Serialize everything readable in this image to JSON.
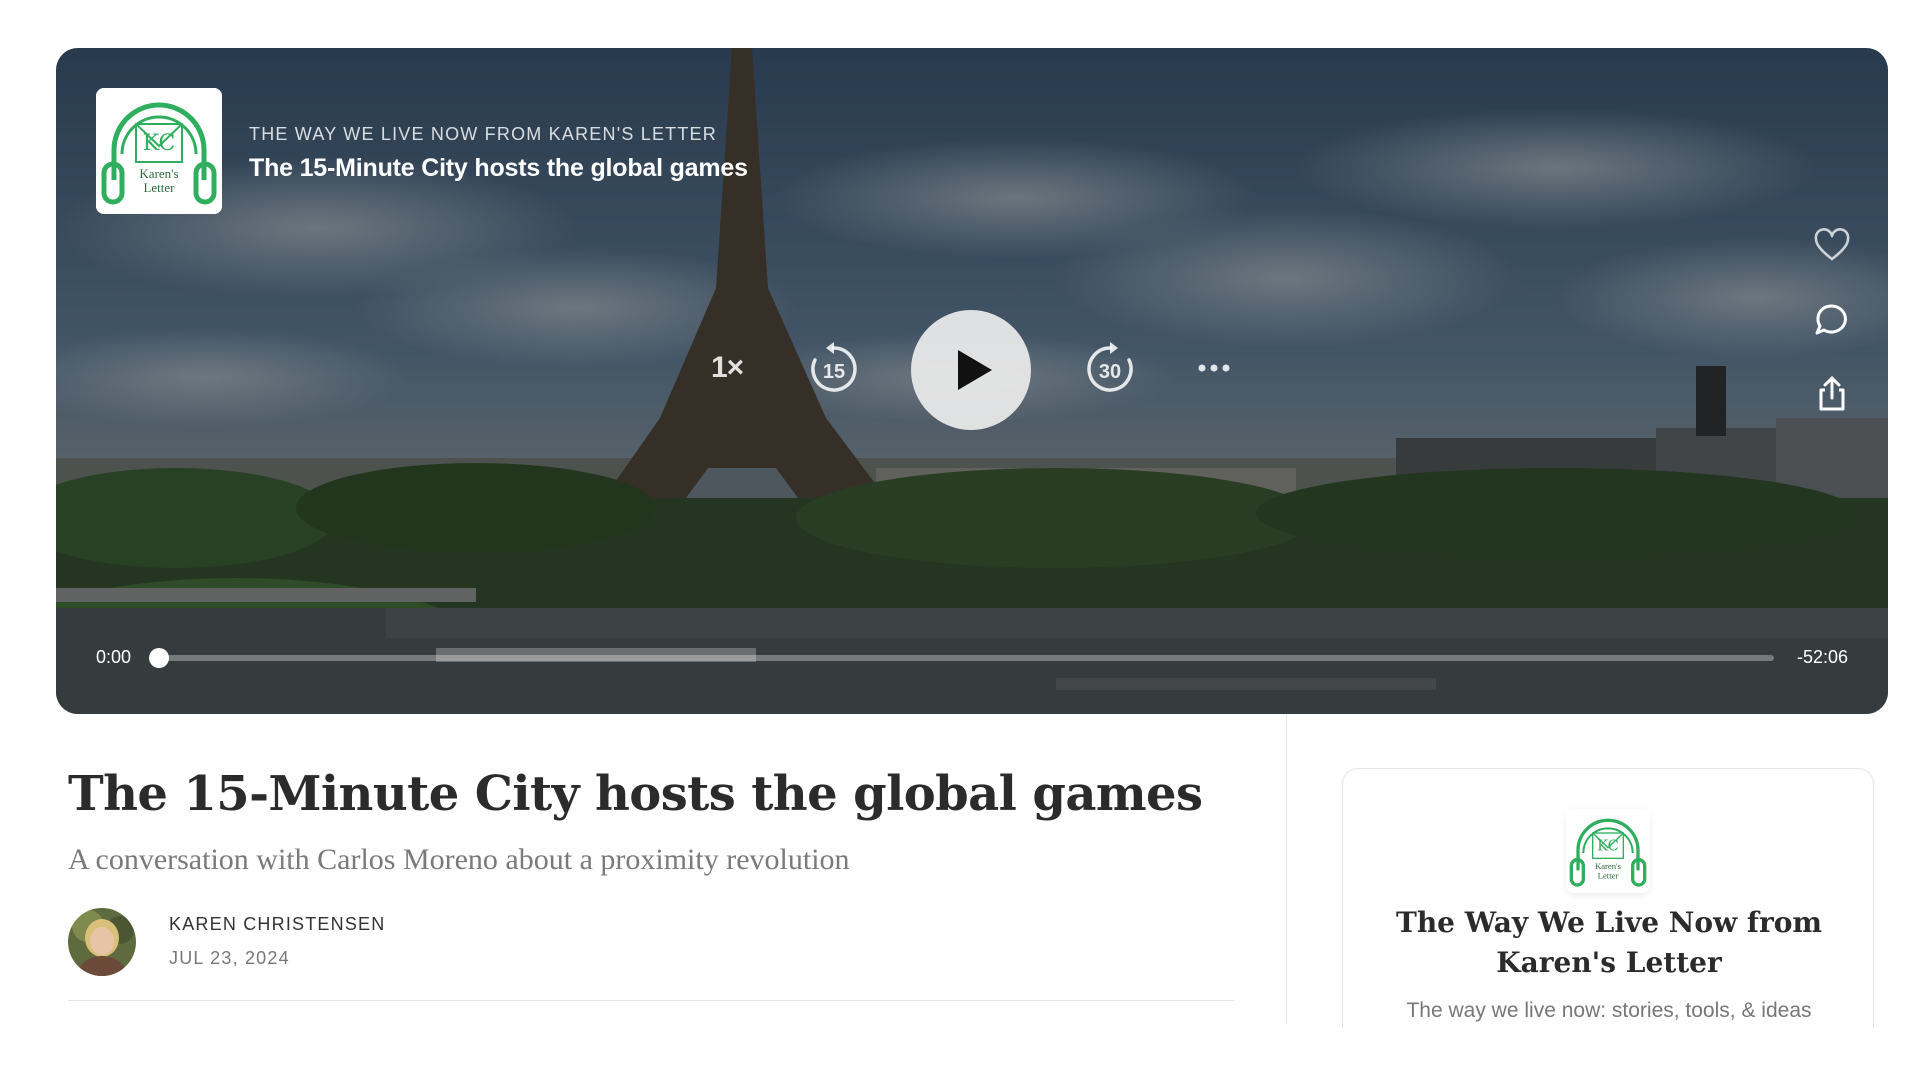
{
  "player": {
    "publication_name": "THE WAY WE LIVE NOW FROM KAREN'S LETTER",
    "episode_title": "The 15-Minute City hosts the global games",
    "cover_art_lines": [
      "Karen's",
      "Letter"
    ],
    "cover_monogram": "KC",
    "speed_label": "1×",
    "skip_back_seconds": "15",
    "skip_forward_seconds": "30",
    "time_elapsed": "0:00",
    "time_remaining": "-52:06",
    "progress": 0,
    "icons": {
      "play": "play-icon",
      "skip_back": "skip-back-icon",
      "skip_forward": "skip-forward-icon",
      "more": "more-horizontal-icon",
      "like": "heart-icon",
      "comment": "comment-icon",
      "share": "share-icon"
    }
  },
  "post": {
    "title": "The 15-Minute City hosts the global games",
    "subtitle": "A conversation with Carlos Moreno about a proximity revolution",
    "author": "KAREN CHRISTENSEN",
    "date": "JUL 23, 2024"
  },
  "publication_card": {
    "title": "The Way We Live Now from Karen's Letter",
    "description": "The way we live now: stories, tools, & ideas"
  },
  "colors": {
    "brand_green": "#2fae5e",
    "text_dark": "#2b2b2b",
    "text_muted": "#777777"
  }
}
